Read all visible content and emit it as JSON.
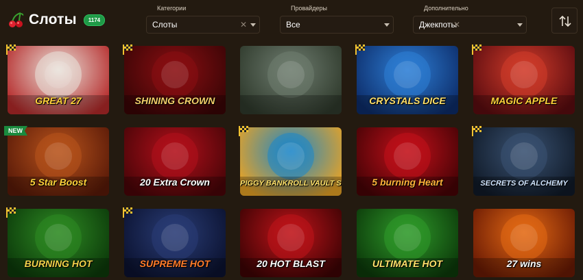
{
  "header": {
    "title": "Слоты",
    "count": "1174"
  },
  "filters": {
    "categories": {
      "label": "Категории",
      "value": "Слоты",
      "clearable": true
    },
    "providers": {
      "label": "Провайдеры",
      "value": "Все",
      "clearable": false
    },
    "extra": {
      "label": "Дополнительно",
      "value": "Джекпоты",
      "clearable": true
    }
  },
  "colors": {
    "accent_green": "#1f9a47",
    "background": "#231a10",
    "field_border": "#3d3124"
  },
  "games": [
    {
      "title": "GREAT 27",
      "badge": "flag",
      "bg1": "#e9e2da",
      "bg2": "#b52a2a",
      "text": "#ffd23a"
    },
    {
      "title": "SHINING CROWN",
      "badge": "flag",
      "bg1": "#8a0f12",
      "bg2": "#3a0506",
      "text": "#f5d06b"
    },
    {
      "title": "",
      "badge": "",
      "bg1": "#6f7d70",
      "bg2": "#2f3a2c",
      "text": "#ffd23a"
    },
    {
      "title": "CRYSTALS DICE",
      "badge": "flag",
      "bg1": "#2e7fd6",
      "bg2": "#0d2d6a",
      "text": "#ffe06a"
    },
    {
      "title": "MAGIC APPLE",
      "badge": "flag",
      "bg1": "#d23c2a",
      "bg2": "#5b0c10",
      "text": "#ffd23a"
    },
    {
      "title": "5 Star Boost",
      "badge": "new",
      "badge_text": "NEW",
      "bg1": "#b8541c",
      "bg2": "#5a1a08",
      "text": "#ffd23a"
    },
    {
      "title": "20 Extra Crown",
      "badge": "",
      "bg1": "#b3101b",
      "bg2": "#4a0508",
      "text": "#ffffff"
    },
    {
      "title": "PIGGY BANKROLL VAULT SMASH",
      "badge": "flag",
      "bg1": "#1d86c8",
      "bg2": "#e6a226",
      "text": "#ffe26b"
    },
    {
      "title": "5 burning Heart",
      "badge": "",
      "bg1": "#c3101a",
      "bg2": "#470306",
      "text": "#ffb23a"
    },
    {
      "title": "SECRETS OF ALCHEMY",
      "badge": "flag",
      "bg1": "#3a5272",
      "bg2": "#101a28",
      "text": "#cfe4ff"
    },
    {
      "title": "BURNING HOT",
      "badge": "flag",
      "bg1": "#2e8a23",
      "bg2": "#0c3a0a",
      "text": "#f2d24a"
    },
    {
      "title": "SUPREME HOT",
      "badge": "flag",
      "bg1": "#2a3d76",
      "bg2": "#0b1230",
      "text": "#ff7b2a"
    },
    {
      "title": "20 HOT BLAST",
      "badge": "",
      "bg1": "#c0141a",
      "bg2": "#3e0304",
      "text": "#ffffff"
    },
    {
      "title": "ULTIMATE HOT",
      "badge": "",
      "bg1": "#2f9a2a",
      "bg2": "#0c3a0a",
      "text": "#ffe26b"
    },
    {
      "title": "27 wins",
      "badge": "",
      "bg1": "#e46a14",
      "bg2": "#6a1a04",
      "text": "#ffffff"
    }
  ]
}
